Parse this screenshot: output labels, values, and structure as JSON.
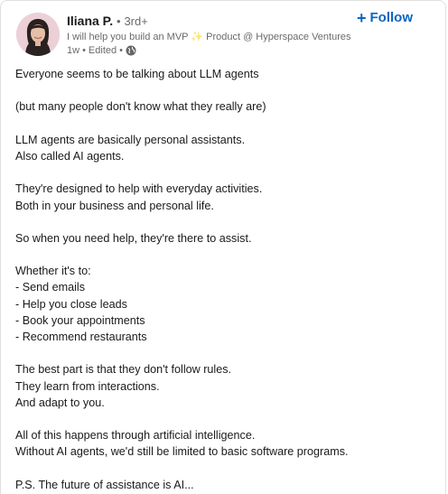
{
  "author": {
    "name": "Iliana P.",
    "separator": "•",
    "degree": "3rd+",
    "headline": "I will help you build an MVP ✨ Product @ Hyperspace Ventures",
    "time": "1w",
    "time_separator": "•",
    "edited": "Edited",
    "time_separator_2": "•",
    "visibility_icon": "globe-icon"
  },
  "follow": {
    "icon": "+",
    "label": "Follow",
    "color": "#0a66c2"
  },
  "post": {
    "lines": [
      "Everyone seems to be talking about LLM agents",
      "",
      "(but many people don't know what they really are)",
      "",
      "LLM agents are basically personal assistants.",
      "Also called AI agents.",
      "",
      "They're designed to help with everyday activities.",
      "Both in your business and personal life.",
      "",
      "So when you need help, they're there to assist.",
      "",
      "Whether it's to:",
      "- Send emails",
      "- Help you close leads",
      "- Book your appointments",
      "- Recommend restaurants",
      "",
      "The best part is that they don't follow rules.",
      "They learn from interactions.",
      "And adapt to you.",
      "",
      "All of this happens through artificial intelligence.",
      "Without AI agents, we'd still be limited to basic software programs.",
      "",
      "P.S. The future of assistance is AI..."
    ]
  }
}
